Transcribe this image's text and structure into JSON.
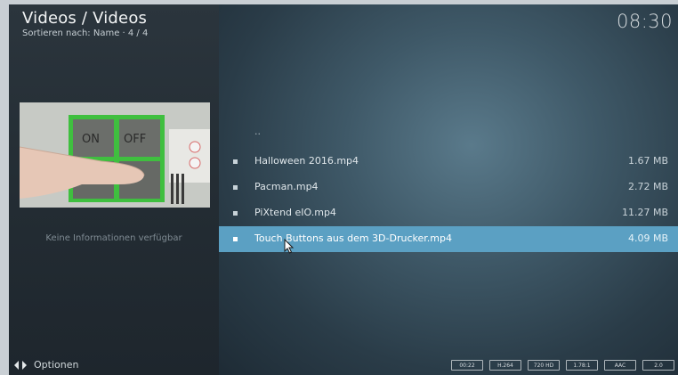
{
  "header": {
    "title": "Videos / Videos",
    "sort_info": "Sortieren nach: Name  ·  4 / 4",
    "clock": "08:30"
  },
  "info_panel": {
    "thumbnail_labels": [
      "ON",
      "OFF"
    ],
    "no_info_text": "Keine Informationen verfügbar"
  },
  "file_list": {
    "parent_item": "..",
    "items": [
      {
        "name": "Halloween 2016.mp4",
        "size": "1.67 MB",
        "selected": false
      },
      {
        "name": "Pacman.mp4",
        "size": "2.72 MB",
        "selected": false
      },
      {
        "name": "PiXtend eIO.mp4",
        "size": "11.27 MB",
        "selected": false
      },
      {
        "name": "Touch Buttons aus dem 3D-Drucker.mp4",
        "size": "4.09 MB",
        "selected": true
      }
    ]
  },
  "footer": {
    "options_label": "Optionen",
    "options_icon": "arrows-left-right-icon",
    "badges": [
      "00:22",
      "H.264",
      "720 HD",
      "1.78:1",
      "AAC",
      "2.0"
    ]
  },
  "colors": {
    "selection": "#5ba0c3",
    "text": "#dfe6ea"
  }
}
